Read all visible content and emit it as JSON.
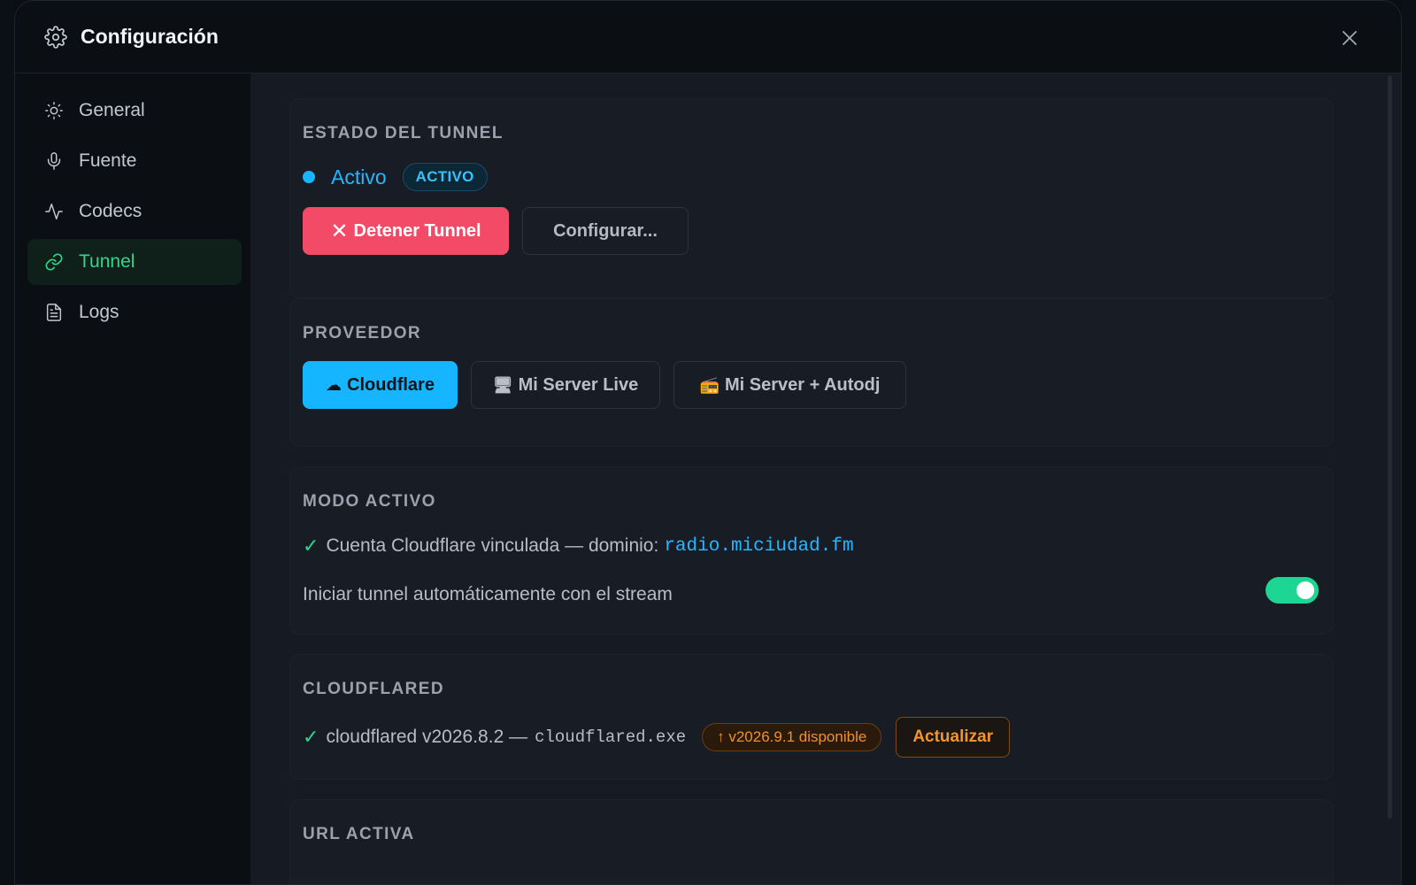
{
  "modal": {
    "title": "Configuración",
    "header_icon": "gear-icon",
    "close_icon": "close-icon"
  },
  "sidebar": {
    "items": [
      {
        "label": "General",
        "icon": "sun-icon",
        "active": false
      },
      {
        "label": "Fuente",
        "icon": "microphone-icon",
        "active": false
      },
      {
        "label": "Codecs",
        "icon": "activity-icon",
        "active": false
      },
      {
        "label": "Tunnel",
        "icon": "link-icon",
        "active": true
      },
      {
        "label": "Logs",
        "icon": "document-icon",
        "active": false
      }
    ]
  },
  "tunnel_status": {
    "section_title": "ESTADO DEL TUNNEL",
    "status_text": "Activo",
    "status_badge": "ACTIVO",
    "stop_label": "Detener Tunnel",
    "configure_label": "Configurar..."
  },
  "provider": {
    "section_title": "PROVEEDOR",
    "options": [
      {
        "label": "Cloudflare",
        "icon": "☁",
        "selected": true
      },
      {
        "label": "Mi Server Live",
        "icon": "🖥",
        "selected": false
      },
      {
        "label": "Mi Server + Autodj",
        "icon": "📻",
        "selected": false
      }
    ]
  },
  "active_mode": {
    "section_title": "MODO ACTIVO",
    "account_text": "Cuenta Cloudflare vinculada — dominio:",
    "domain": "radio.miciudad.fm",
    "autostart_label": "Iniciar tunnel automáticamente con el stream",
    "autostart_enabled": true
  },
  "cloudflared": {
    "section_title": "CLOUDFLARED",
    "version_text": "cloudflared v2026.8.2 —",
    "exe_name": "cloudflared.exe",
    "update_available": "↑ v2026.9.1 disponible",
    "update_label": "Actualizar"
  },
  "active_url": {
    "section_title": "URL ACTIVA"
  },
  "colors": {
    "accent_green": "#2ed68f",
    "accent_blue": "#16b5ff",
    "danger": "#f24a67",
    "warning": "#f0902a"
  }
}
